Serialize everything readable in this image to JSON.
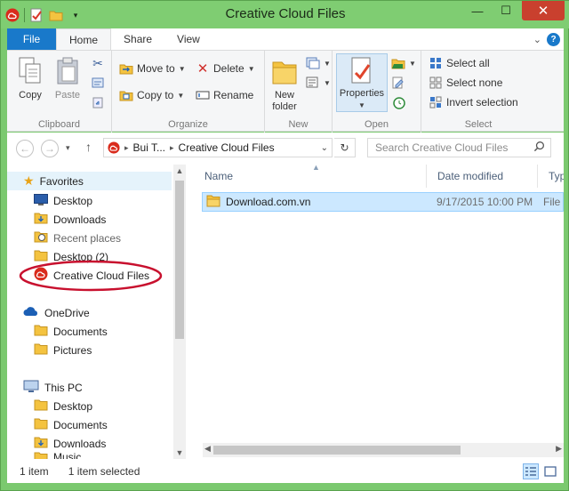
{
  "window": {
    "title": "Creative Cloud Files",
    "minimize": "—",
    "maximize": "☐",
    "close": "✕"
  },
  "tabs": [
    {
      "label": "File"
    },
    {
      "label": "Home"
    },
    {
      "label": "Share"
    },
    {
      "label": "View"
    }
  ],
  "ribbon": {
    "clipboard": {
      "label": "Clipboard",
      "copy": "Copy",
      "paste": "Paste"
    },
    "organize": {
      "label": "Organize",
      "move_to": "Move to",
      "copy_to": "Copy to",
      "delete": "Delete",
      "rename": "Rename"
    },
    "new": {
      "label": "New",
      "new_folder_line1": "New",
      "new_folder_line2": "folder"
    },
    "open": {
      "label": "Open",
      "properties": "Properties"
    },
    "select": {
      "label": "Select",
      "select_all": "Select all",
      "select_none": "Select none",
      "invert": "Invert selection"
    }
  },
  "address": {
    "crumbs": [
      "Bui T...",
      "Creative Cloud Files"
    ],
    "search_placeholder": "Search Creative Cloud Files"
  },
  "nav": {
    "favorites": "Favorites",
    "items": [
      {
        "label": "Desktop"
      },
      {
        "label": "Downloads"
      },
      {
        "label": "Recent places"
      },
      {
        "label": "Desktop (2)"
      },
      {
        "label": "Creative Cloud Files"
      }
    ],
    "onedrive": "OneDrive",
    "onedrive_items": [
      {
        "label": "Documents"
      },
      {
        "label": "Pictures"
      }
    ],
    "thispc": "This PC",
    "thispc_items": [
      {
        "label": "Desktop"
      },
      {
        "label": "Documents"
      },
      {
        "label": "Downloads"
      },
      {
        "label": "Music"
      }
    ]
  },
  "files": {
    "columns": [
      "Name",
      "Date modified",
      "Typ"
    ],
    "rows": [
      {
        "name": "Download.com.vn",
        "date": "9/17/2015 10:00 PM",
        "type": "File"
      }
    ]
  },
  "status": {
    "count": "1 item",
    "selected": "1 item selected"
  },
  "colors": {
    "title_green": "#7fcd72",
    "file_tab_blue": "#1979ca",
    "selection_blue": "#cce8ff",
    "highlight_ellipse": "#c8102e"
  }
}
